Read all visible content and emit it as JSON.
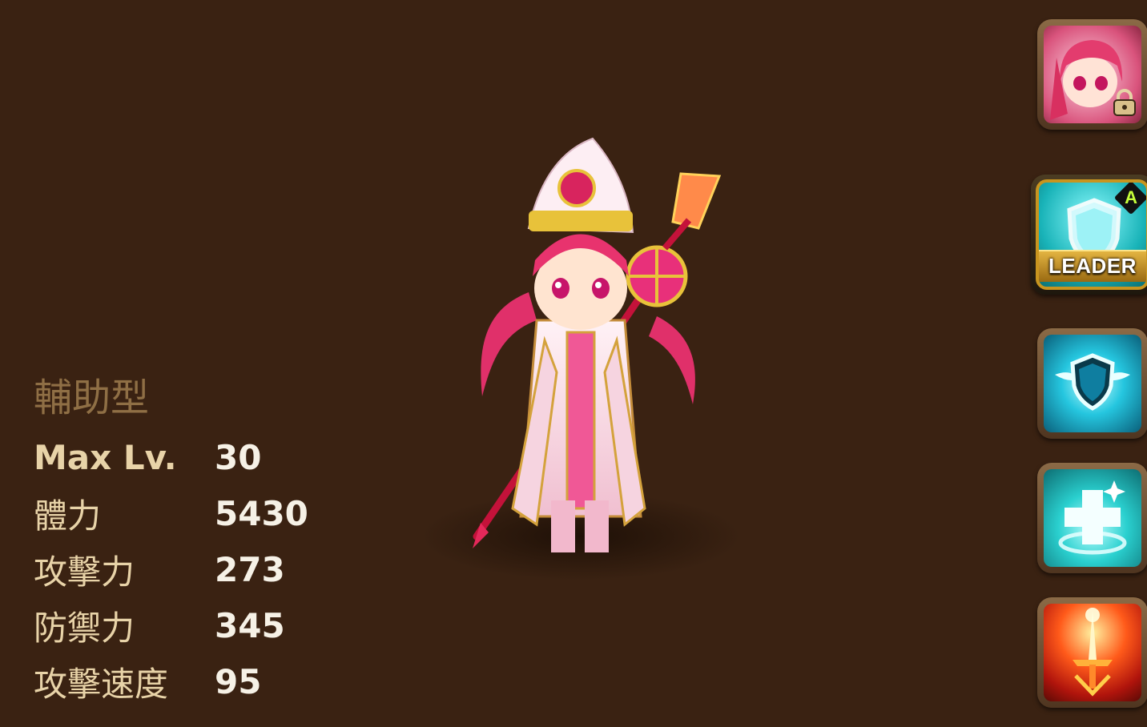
{
  "monster": {
    "type": "輔助型",
    "stats": [
      {
        "label": "Max Lv.",
        "value": "30"
      },
      {
        "label": "體力",
        "value": "5430"
      },
      {
        "label": "攻擊力",
        "value": "273"
      },
      {
        "label": "防禦力",
        "value": "345"
      },
      {
        "label": "攻擊速度",
        "value": "95"
      }
    ]
  },
  "sidebar": {
    "portrait": {
      "icon": "monster-portrait-icon",
      "locked": true,
      "lock_icon": "lock-icon"
    },
    "leader_skill": {
      "label": "LEADER",
      "icon": "shield-icon",
      "grade_badge": "A"
    },
    "skills": [
      {
        "icon": "winged-shield-icon"
      },
      {
        "icon": "heal-cross-icon"
      },
      {
        "icon": "sword-icon"
      }
    ]
  },
  "colors": {
    "background": "#3a2212",
    "type_label": "#8f6f45",
    "stat_label": "#e8d3a8",
    "stat_value": "#f6f1e6",
    "leader_frame": "#c8951f"
  }
}
